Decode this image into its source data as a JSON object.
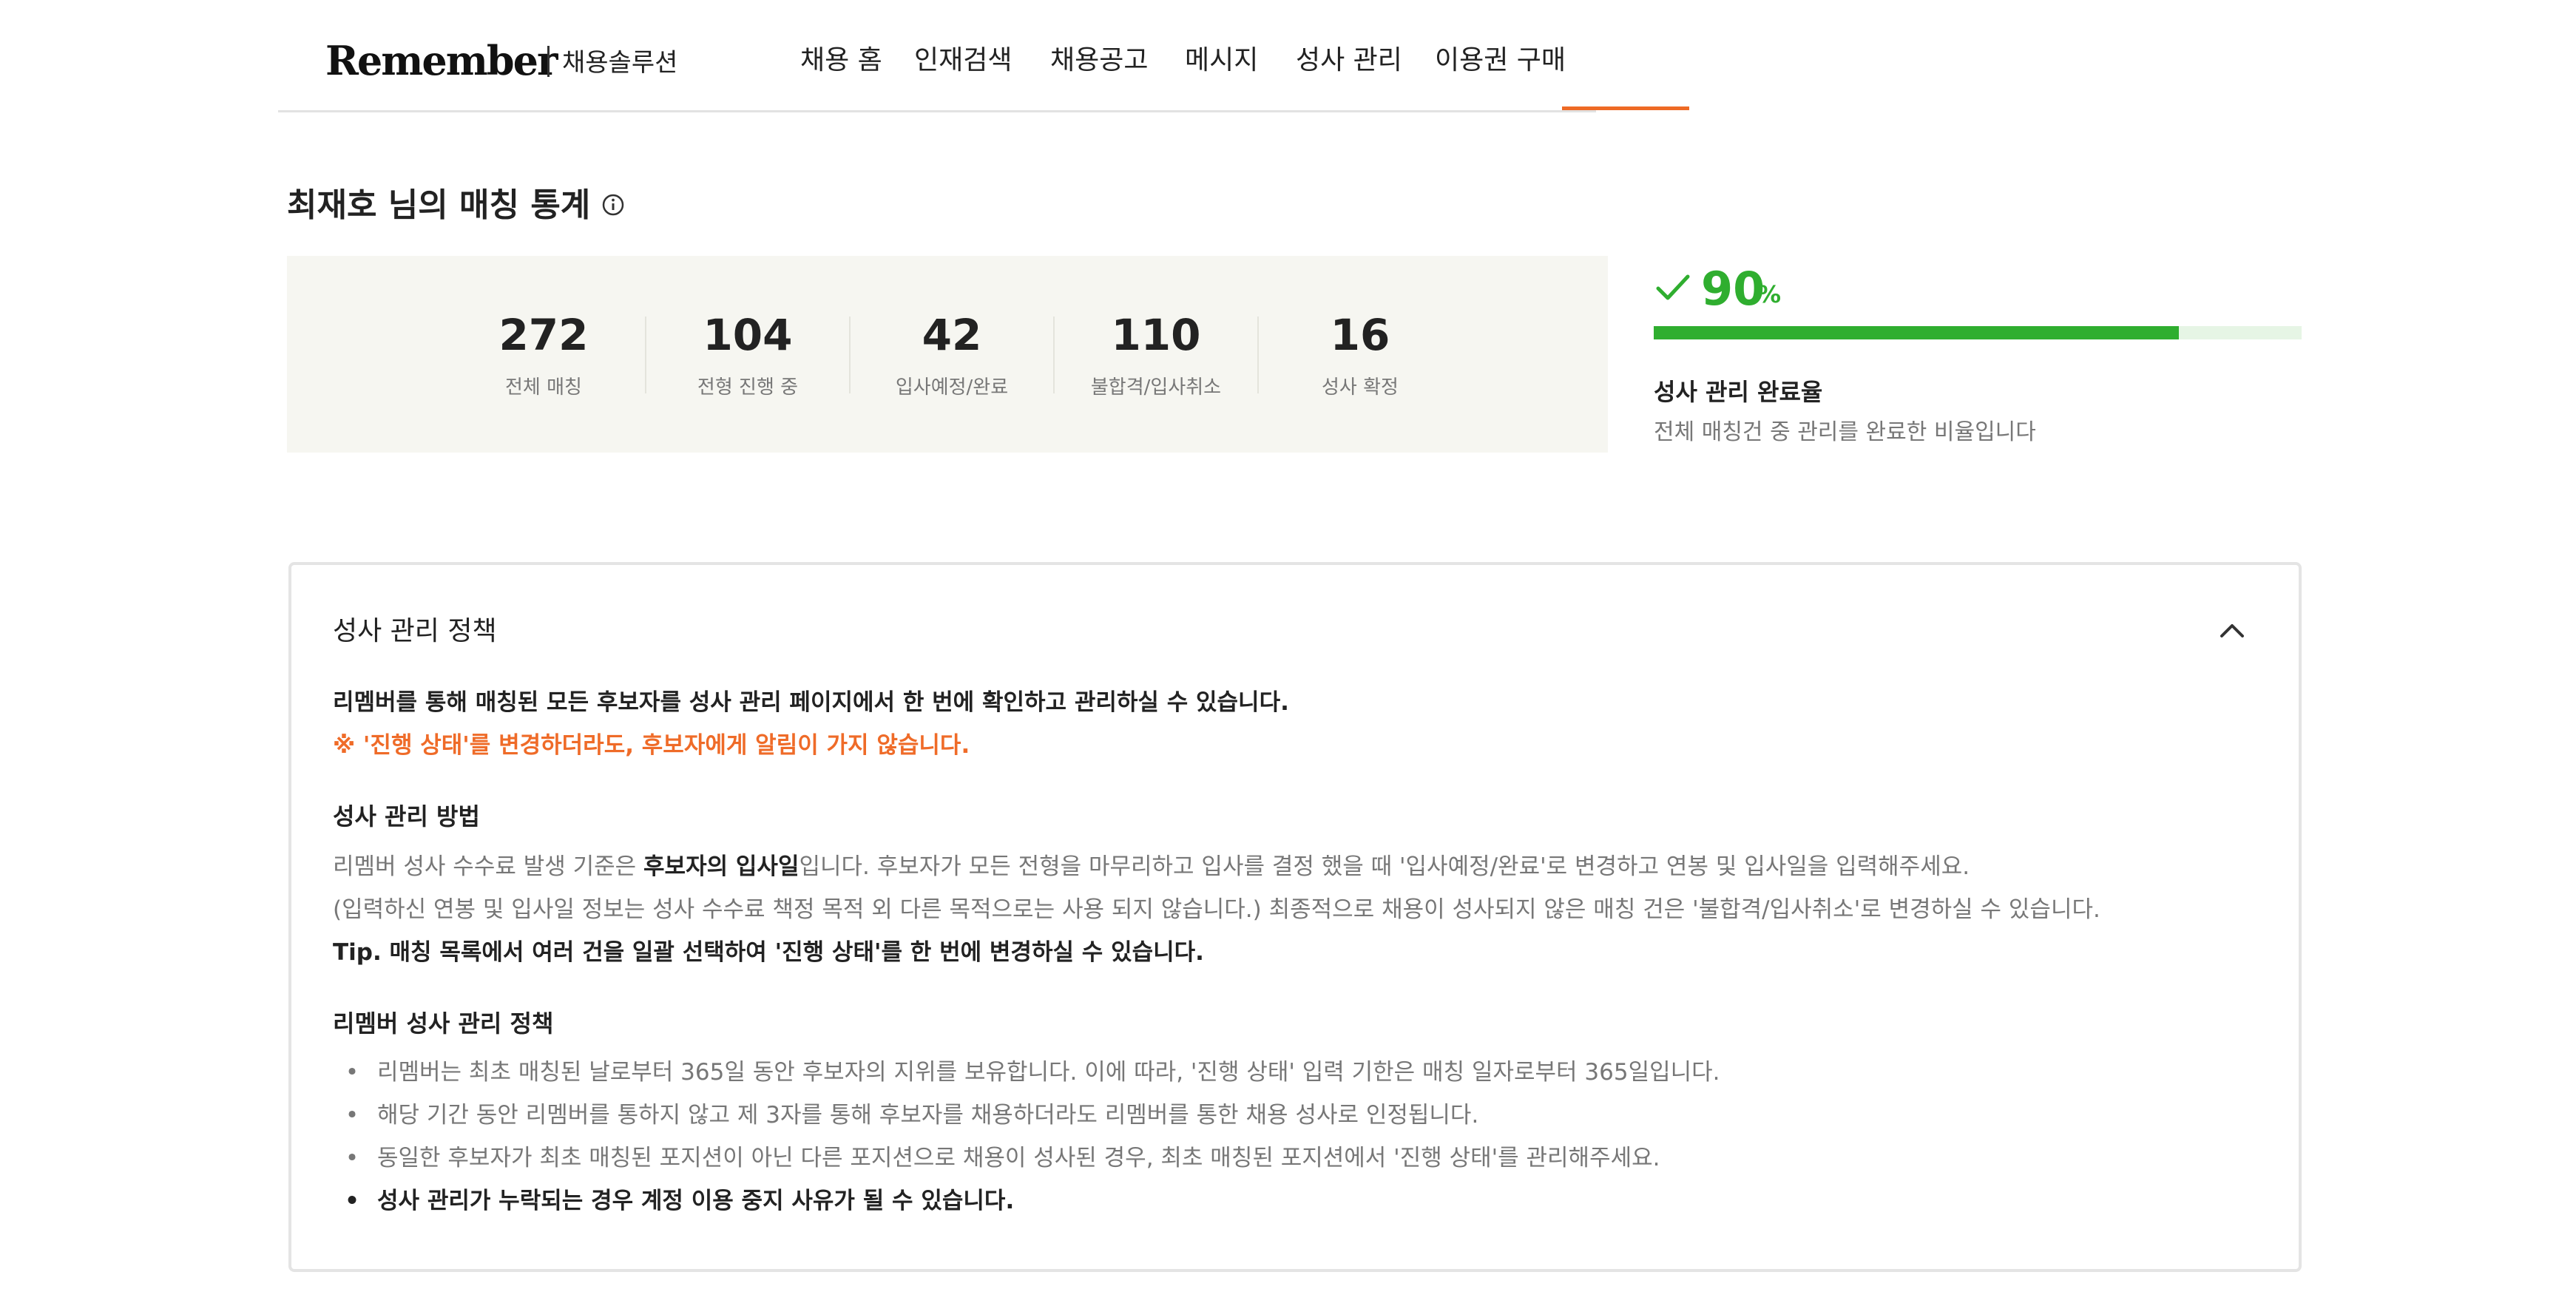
{
  "header": {
    "logo": "Remember",
    "logo_sub": "채용솔루션",
    "nav": [
      {
        "label": "채용 홈"
      },
      {
        "label": "인재검색"
      },
      {
        "label": "채용공고"
      },
      {
        "label": "메시지"
      },
      {
        "label": "성사 관리",
        "active": true
      },
      {
        "label": "이용권 구매"
      }
    ],
    "accent_color": "#ee6a25"
  },
  "page_title": "최재호 님의 매칭 통계",
  "info_icon": "info-circle-icon",
  "stats": [
    {
      "value": "272",
      "label": "전체 매칭"
    },
    {
      "value": "104",
      "label": "전형 진행 중"
    },
    {
      "value": "42",
      "label": "입사예정/완료"
    },
    {
      "value": "110",
      "label": "불합격/입사취소"
    },
    {
      "value": "16",
      "label": "성사 확정"
    }
  ],
  "completion": {
    "percent": 90,
    "value_text": "90",
    "unit": "%",
    "title": "성사 관리 완료율",
    "description": "전체 매칭건 중 관리를 완료한 비율입니다",
    "color": "#2fae2f",
    "icon": "check-icon"
  },
  "policy": {
    "title": "성사 관리 정책",
    "collapse_icon": "chevron-up-icon",
    "intro": "리멤버를 통해 매칭된 모든 후보자를 성사 관리 페이지에서 한 번에 확인하고 관리하실 수 있습니다.",
    "warning": "※ '진행 상태'를 변경하더라도, 후보자에게 알림이 가지 않습니다.",
    "method_heading": "성사 관리 방법",
    "method_line1_pre": "리멤버 성사 수수료 발생 기준은 ",
    "method_line1_strong": "후보자의 입사일",
    "method_line1_post": "입니다. 후보자가 모든 전형을 마무리하고 입사를 결정 했을 때 '입사예정/완료'로 변경하고 연봉 및 입사일을 입력해주세요.",
    "method_line2": "(입력하신 연봉 및 입사일 정보는 성사 수수료 책정 목적 외 다른 목적으로는 사용 되지 않습니다.) 최종적으로 채용이 성사되지 않은 매칭 건은 '불합격/입사취소'로 변경하실 수 있습니다.",
    "method_tip": "Tip. 매칭 목록에서 여러 건을 일괄 선택하여 '진행 상태'를 한 번에 변경하실 수 있습니다.",
    "rules_heading": "리멤버 성사 관리 정책",
    "bullet": "•",
    "rules": [
      "리멤버는 최초 매칭된 날로부터 365일 동안 후보자의 지위를 보유합니다. 이에 따라, '진행 상태' 입력 기한은 매칭 일자로부터 365일입니다.",
      "해당 기간 동안 리멤버를 통하지 않고 제 3자를 통해 후보자를 채용하더라도 리멤버를 통한 채용 성사로 인정됩니다.",
      "동일한 후보자가 최초 매칭된 포지션이 아닌 다른 포지션으로 채용이 성사된 경우, 최초 매칭된 포지션에서 '진행 상태'를 관리해주세요.",
      "성사 관리가 누락되는 경우 계정 이용 중지 사유가 될 수 있습니다."
    ]
  }
}
